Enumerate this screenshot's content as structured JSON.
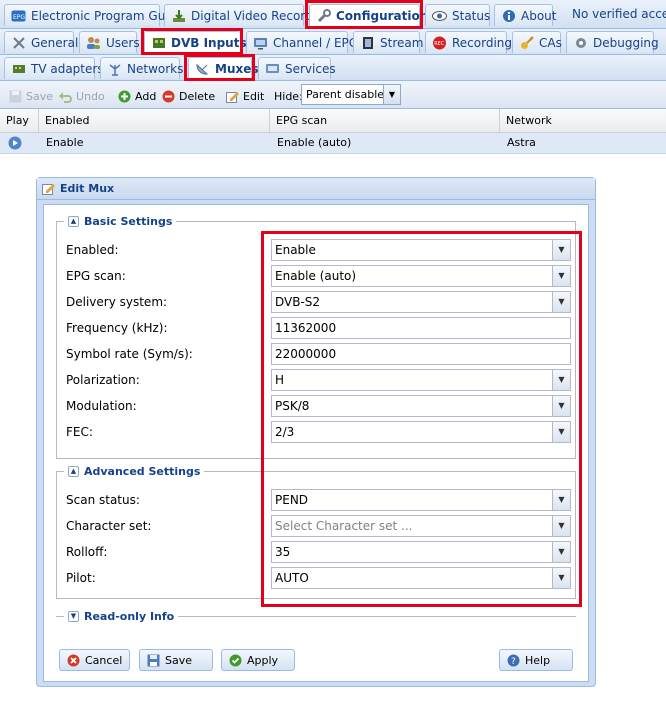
{
  "top_tabs": [
    {
      "label": "Electronic Program Guide",
      "icon": "epg-icon"
    },
    {
      "label": "Digital Video Recorder",
      "icon": "download-icon"
    },
    {
      "label": "Configuration",
      "icon": "wrench-icon"
    },
    {
      "label": "Status",
      "icon": "eye-icon"
    },
    {
      "label": "About",
      "icon": "info-icon"
    }
  ],
  "access_text": "No verified access",
  "config_tabs": [
    {
      "label": "General",
      "icon": "tools-icon"
    },
    {
      "label": "Users",
      "icon": "users-icon"
    },
    {
      "label": "DVB Inputs",
      "icon": "dvb-card-icon"
    },
    {
      "label": "Channel / EPG",
      "icon": "tv-icon"
    },
    {
      "label": "Stream",
      "icon": "film-icon"
    },
    {
      "label": "Recording",
      "icon": "rec-icon"
    },
    {
      "label": "CAs",
      "icon": "key-icon"
    },
    {
      "label": "Debugging",
      "icon": "gear-icon"
    }
  ],
  "dvb_tabs": [
    {
      "label": "TV adapters",
      "icon": "adapter-icon"
    },
    {
      "label": "Networks",
      "icon": "antenna-icon"
    },
    {
      "label": "Muxes",
      "icon": "satellite-dish-icon"
    },
    {
      "label": "Services",
      "icon": "tv-services-icon"
    }
  ],
  "toolbar": {
    "save": "Save",
    "undo": "Undo",
    "add": "Add",
    "delete": "Delete",
    "edit": "Edit",
    "hide_label": "Hide:",
    "hide_value": "Parent disabled"
  },
  "grid": {
    "columns": [
      "Play",
      "Enabled",
      "EPG scan",
      "Network"
    ],
    "rows": [
      {
        "enabled": "Enable",
        "epg_scan": "Enable (auto)",
        "network": "Astra"
      }
    ]
  },
  "dialog": {
    "title": "Edit Mux",
    "basic_legend": "Basic Settings",
    "advanced_legend": "Advanced Settings",
    "readonly_legend": "Read-only Info",
    "basic_fields": [
      {
        "label": "Enabled:",
        "value": "Enable",
        "type": "combo"
      },
      {
        "label": "EPG scan:",
        "value": "Enable (auto)",
        "type": "combo"
      },
      {
        "label": "Delivery system:",
        "value": "DVB-S2",
        "type": "combo"
      },
      {
        "label": "Frequency (kHz):",
        "value": "11362000",
        "type": "text"
      },
      {
        "label": "Symbol rate (Sym/s):",
        "value": "22000000",
        "type": "text"
      },
      {
        "label": "Polarization:",
        "value": "H",
        "type": "combo"
      },
      {
        "label": "Modulation:",
        "value": "PSK/8",
        "type": "combo"
      },
      {
        "label": "FEC:",
        "value": "2/3",
        "type": "combo"
      }
    ],
    "advanced_fields": [
      {
        "label": "Scan status:",
        "value": "PEND",
        "type": "combo"
      },
      {
        "label": "Character set:",
        "placeholder": "Select Character set ...",
        "type": "combo"
      },
      {
        "label": "Rolloff:",
        "value": "35",
        "type": "combo"
      },
      {
        "label": "Pilot:",
        "value": "AUTO",
        "type": "combo"
      }
    ],
    "buttons": {
      "cancel": "Cancel",
      "save": "Save",
      "apply": "Apply",
      "help": "Help"
    }
  },
  "colors": {
    "highlight": "#e3001b",
    "panel_border": "#99bbe8",
    "tab_text": "#15428b"
  }
}
